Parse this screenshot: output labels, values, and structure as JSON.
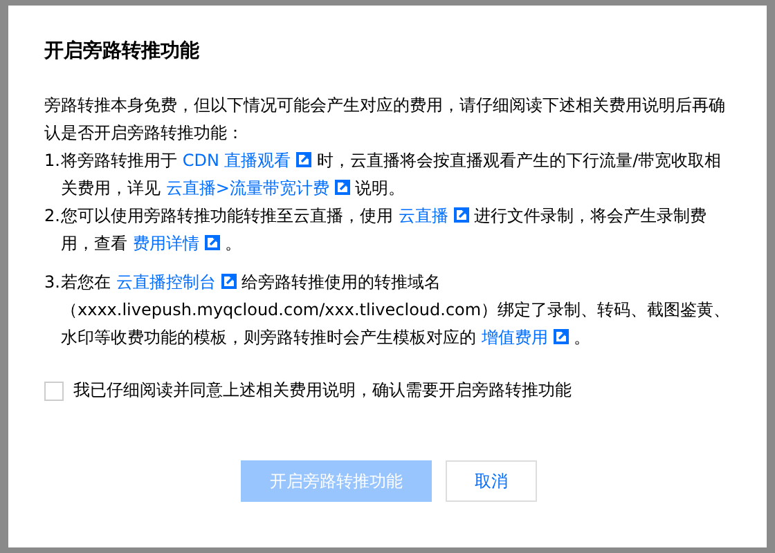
{
  "dialog": {
    "title": "开启旁路转推功能",
    "intro": "旁路转推本身免费，但以下情况可能会产生对应的费用，请仔细阅读下述相关费用说明后再确认是否开启旁路转推功能：",
    "items": [
      {
        "number": "1.",
        "segments": [
          {
            "kind": "text",
            "text": "将旁路转推用于 "
          },
          {
            "kind": "link",
            "text": "CDN 直播观看"
          },
          {
            "kind": "text",
            "text": " 时，云直播将会按直播观看产生的下行流量/带宽收取相关费用，详见 "
          },
          {
            "kind": "link",
            "text": "云直播>流量带宽计费"
          },
          {
            "kind": "text",
            "text": " 说明。"
          }
        ]
      },
      {
        "number": "2.",
        "segments": [
          {
            "kind": "text",
            "text": "您可以使用旁路转推功能转推至云直播，使用 "
          },
          {
            "kind": "link",
            "text": "云直播"
          },
          {
            "kind": "text",
            "text": " 进行文件录制，将会产生录制费用，查看 "
          },
          {
            "kind": "link",
            "text": "费用详情"
          },
          {
            "kind": "text",
            "text": " 。"
          }
        ]
      },
      {
        "number": "3.",
        "segments": [
          {
            "kind": "text",
            "text": "若您在 "
          },
          {
            "kind": "link",
            "text": "云直播控制台"
          },
          {
            "kind": "text",
            "text": " 给旁路转推使用的转推域名（xxxx.livepush.myqcloud.com/xxx.tlivecloud.com）绑定了录制、转码、截图鉴黄、水印等收费功能的模板，则旁路转推时会产生模板对应的 "
          },
          {
            "kind": "link",
            "text": "增值费用"
          },
          {
            "kind": "text",
            "text": " 。"
          }
        ]
      }
    ],
    "agreement": {
      "label": "我已仔细阅读并同意上述相关费用说明，确认需要开启旁路转推功能",
      "checked": false
    },
    "buttons": [
      {
        "label": "开启旁路转推功能",
        "kind": "primary",
        "disabled": true
      },
      {
        "label": "取消",
        "kind": "secondary",
        "disabled": false
      }
    ]
  }
}
